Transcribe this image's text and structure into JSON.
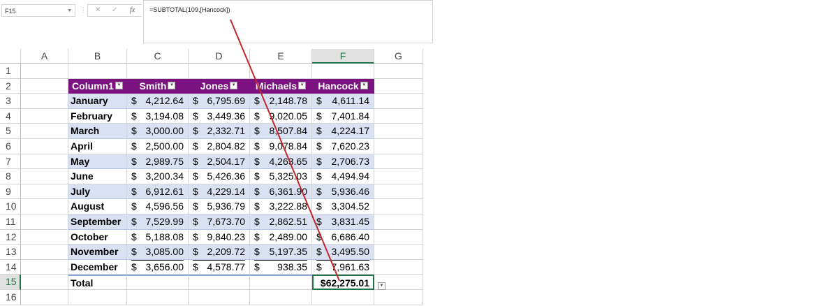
{
  "name_box": "F15",
  "formula_bar": {
    "cancel": "✕",
    "enter": "✓",
    "fx": "fx",
    "formula": "=SUBTOTAL(109,[Hancock])"
  },
  "columns": [
    "A",
    "B",
    "C",
    "D",
    "E",
    "F",
    "G"
  ],
  "selected_column": "F",
  "rows": [
    "1",
    "2",
    "3",
    "4",
    "5",
    "6",
    "7",
    "8",
    "9",
    "10",
    "11",
    "12",
    "13",
    "14",
    "15",
    "16"
  ],
  "selected_row": "15",
  "table": {
    "headers": [
      "Column1",
      "Smith",
      "Jones",
      "Michaels",
      "Hancock"
    ],
    "currency": "$",
    "data": [
      [
        "January",
        "4,212.64",
        "6,795.69",
        "2,148.78",
        "4,611.14"
      ],
      [
        "February",
        "3,194.08",
        "3,449.36",
        "9,020.05",
        "7,401.84"
      ],
      [
        "March",
        "3,000.00",
        "2,332.71",
        "8,507.84",
        "4,224.17"
      ],
      [
        "April",
        "2,500.00",
        "2,804.82",
        "9,078.84",
        "7,620.23"
      ],
      [
        "May",
        "2,989.75",
        "2,504.17",
        "4,263.65",
        "2,706.73"
      ],
      [
        "June",
        "3,200.34",
        "5,426.36",
        "5,325.03",
        "4,494.94"
      ],
      [
        "July",
        "6,912.61",
        "4,229.14",
        "6,361.90",
        "5,936.46"
      ],
      [
        "August",
        "4,596.56",
        "5,936.79",
        "3,222.88",
        "3,304.52"
      ],
      [
        "September",
        "7,529.99",
        "7,673.70",
        "2,862.51",
        "3,831.45"
      ],
      [
        "October",
        "5,188.08",
        "9,840.23",
        "2,489.00",
        "6,686.40"
      ],
      [
        "November",
        "3,085.00",
        "2,209.72",
        "5,197.35",
        "3,495.50"
      ],
      [
        "December",
        "3,656.00",
        "4,578.77",
        "938.35",
        "7,961.63"
      ]
    ],
    "total_label": "Total",
    "total_value": "$62,275.01"
  },
  "colors": {
    "header": "#7b127f",
    "band": "#d9e1f2",
    "annotation": "#c0282d"
  }
}
